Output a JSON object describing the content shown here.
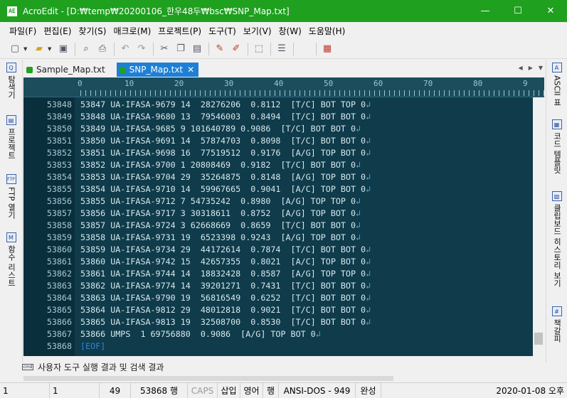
{
  "window": {
    "app_icon": "AE",
    "title": "AcroEdit - [D:₩temp₩20200106_한우48두₩bsc₩SNP_Map.txt]",
    "minimize": "—",
    "maximize": "☐",
    "close": "✕"
  },
  "menu": [
    "파일(F)",
    "편집(E)",
    "찾기(S)",
    "매크로(M)",
    "프로젝트(P)",
    "도구(T)",
    "보기(V)",
    "창(W)",
    "도움말(H)"
  ],
  "left_panel": [
    {
      "icon": "Q",
      "label": "탐색기"
    },
    {
      "icon": "▤",
      "label": "프로젝트"
    },
    {
      "icon": "FTP",
      "label": "FTP 열기"
    },
    {
      "icon": "M",
      "label": "함수 리스트"
    }
  ],
  "right_panel": [
    {
      "icon": "A",
      "label": "ASCII 표"
    },
    {
      "icon": "▦",
      "label": "코드 템플릿"
    },
    {
      "icon": "▧",
      "label": "클립보드 히스토리 보기"
    },
    {
      "icon": "#",
      "label": "책갈피"
    }
  ],
  "tabs": [
    {
      "label": "Sample_Map.txt",
      "active": false,
      "color": "#22a022"
    },
    {
      "label": "SNP_Map.txt",
      "active": true,
      "color": "#22a022"
    }
  ],
  "tab_close": "✕",
  "tab_nav": [
    "◀",
    "▶",
    "▼"
  ],
  "ruler": [
    "0",
    "10",
    "20",
    "30",
    "40",
    "50",
    "60",
    "70",
    "80",
    "9"
  ],
  "lines": [
    {
      "n": "53848",
      "t": "53847 UA-IFASA-9679 14  28276206  0.8112  [T/C] BOT TOP 0"
    },
    {
      "n": "53849",
      "t": "53848 UA-IFASA-9680 13  79546003  0.8494  [T/C] BOT BOT 0"
    },
    {
      "n": "53850",
      "t": "53849 UA-IFASA-9685 9 101640789 0.9086  [T/C] BOT BOT 0"
    },
    {
      "n": "53851",
      "t": "53850 UA-IFASA-9691 14  57874703  0.8098  [T/C] BOT BOT 0"
    },
    {
      "n": "53852",
      "t": "53851 UA-IFASA-9698 16  77519512  0.9176  [A/G] TOP BOT 0"
    },
    {
      "n": "53853",
      "t": "53852 UA-IFASA-9700 1 20808469  0.9182  [T/C] BOT BOT 0"
    },
    {
      "n": "53854",
      "t": "53853 UA-IFASA-9704 29  35264875  0.8148  [A/G] TOP BOT 0"
    },
    {
      "n": "53855",
      "t": "53854 UA-IFASA-9710 14  59967665  0.9041  [A/C] TOP BOT 0"
    },
    {
      "n": "53856",
      "t": "53855 UA-IFASA-9712 7 54735242  0.8980  [A/G] TOP TOP 0"
    },
    {
      "n": "53857",
      "t": "53856 UA-IFASA-9717 3 30318611  0.8752  [A/G] TOP BOT 0"
    },
    {
      "n": "53858",
      "t": "53857 UA-IFASA-9724 3 62668669  0.8659  [T/C] BOT BOT 0"
    },
    {
      "n": "53859",
      "t": "53858 UA-IFASA-9731 19  6523398 0.9243  [A/G] TOP BOT 0"
    },
    {
      "n": "53860",
      "t": "53859 UA-IFASA-9734 29  44172614  0.7874  [T/C] BOT BOT 0"
    },
    {
      "n": "53861",
      "t": "53860 UA-IFASA-9742 15  42657355  0.8021  [A/C] TOP BOT 0"
    },
    {
      "n": "53862",
      "t": "53861 UA-IFASA-9744 14  18832428  0.8587  [A/G] TOP TOP 0"
    },
    {
      "n": "53863",
      "t": "53862 UA-IFASA-9774 14  39201271  0.7431  [T/C] BOT BOT 0"
    },
    {
      "n": "53864",
      "t": "53863 UA-IFASA-9790 19  56816549  0.6252  [T/C] BOT BOT 0"
    },
    {
      "n": "53865",
      "t": "53864 UA-IFASA-9812 29  48012818  0.9021  [T/C] BOT BOT 0"
    },
    {
      "n": "53866",
      "t": "53865 UA-IFASA-9813 19  32508700  0.8530  [T/C] BOT BOT 0"
    },
    {
      "n": "53867",
      "t": "53866 UMPS  1 69756880  0.9086  [A/G] TOP BOT 0"
    }
  ],
  "last_line": {
    "n": "53868",
    "t": "[EOF]"
  },
  "eol_mark": "↲",
  "output_panel": {
    "icon": "cmd",
    "label": "사용자 도구 실행 결과 및 검색 결과"
  },
  "status": [
    "1",
    "1",
    "49",
    "53868 행",
    "CAPS",
    "삽입",
    "영어",
    "행",
    "ANSI-DOS - 949",
    "완성",
    "2020-01-08 오후"
  ]
}
